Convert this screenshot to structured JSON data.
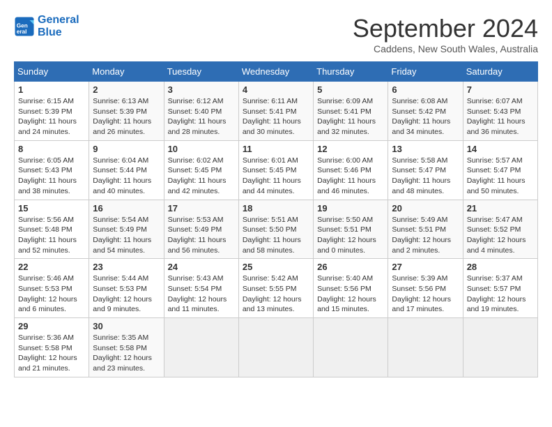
{
  "header": {
    "logo_line1": "General",
    "logo_line2": "Blue",
    "month_title": "September 2024",
    "subtitle": "Caddens, New South Wales, Australia"
  },
  "weekdays": [
    "Sunday",
    "Monday",
    "Tuesday",
    "Wednesday",
    "Thursday",
    "Friday",
    "Saturday"
  ],
  "weeks": [
    [
      {
        "day": "1",
        "sunrise": "6:15 AM",
        "sunset": "5:39 PM",
        "daylight": "11 hours and 24 minutes."
      },
      {
        "day": "2",
        "sunrise": "6:13 AM",
        "sunset": "5:39 PM",
        "daylight": "11 hours and 26 minutes."
      },
      {
        "day": "3",
        "sunrise": "6:12 AM",
        "sunset": "5:40 PM",
        "daylight": "11 hours and 28 minutes."
      },
      {
        "day": "4",
        "sunrise": "6:11 AM",
        "sunset": "5:41 PM",
        "daylight": "11 hours and 30 minutes."
      },
      {
        "day": "5",
        "sunrise": "6:09 AM",
        "sunset": "5:41 PM",
        "daylight": "11 hours and 32 minutes."
      },
      {
        "day": "6",
        "sunrise": "6:08 AM",
        "sunset": "5:42 PM",
        "daylight": "11 hours and 34 minutes."
      },
      {
        "day": "7",
        "sunrise": "6:07 AM",
        "sunset": "5:43 PM",
        "daylight": "11 hours and 36 minutes."
      }
    ],
    [
      {
        "day": "8",
        "sunrise": "6:05 AM",
        "sunset": "5:43 PM",
        "daylight": "11 hours and 38 minutes."
      },
      {
        "day": "9",
        "sunrise": "6:04 AM",
        "sunset": "5:44 PM",
        "daylight": "11 hours and 40 minutes."
      },
      {
        "day": "10",
        "sunrise": "6:02 AM",
        "sunset": "5:45 PM",
        "daylight": "11 hours and 42 minutes."
      },
      {
        "day": "11",
        "sunrise": "6:01 AM",
        "sunset": "5:45 PM",
        "daylight": "11 hours and 44 minutes."
      },
      {
        "day": "12",
        "sunrise": "6:00 AM",
        "sunset": "5:46 PM",
        "daylight": "11 hours and 46 minutes."
      },
      {
        "day": "13",
        "sunrise": "5:58 AM",
        "sunset": "5:47 PM",
        "daylight": "11 hours and 48 minutes."
      },
      {
        "day": "14",
        "sunrise": "5:57 AM",
        "sunset": "5:47 PM",
        "daylight": "11 hours and 50 minutes."
      }
    ],
    [
      {
        "day": "15",
        "sunrise": "5:56 AM",
        "sunset": "5:48 PM",
        "daylight": "11 hours and 52 minutes."
      },
      {
        "day": "16",
        "sunrise": "5:54 AM",
        "sunset": "5:49 PM",
        "daylight": "11 hours and 54 minutes."
      },
      {
        "day": "17",
        "sunrise": "5:53 AM",
        "sunset": "5:49 PM",
        "daylight": "11 hours and 56 minutes."
      },
      {
        "day": "18",
        "sunrise": "5:51 AM",
        "sunset": "5:50 PM",
        "daylight": "11 hours and 58 minutes."
      },
      {
        "day": "19",
        "sunrise": "5:50 AM",
        "sunset": "5:51 PM",
        "daylight": "12 hours and 0 minutes."
      },
      {
        "day": "20",
        "sunrise": "5:49 AM",
        "sunset": "5:51 PM",
        "daylight": "12 hours and 2 minutes."
      },
      {
        "day": "21",
        "sunrise": "5:47 AM",
        "sunset": "5:52 PM",
        "daylight": "12 hours and 4 minutes."
      }
    ],
    [
      {
        "day": "22",
        "sunrise": "5:46 AM",
        "sunset": "5:53 PM",
        "daylight": "12 hours and 6 minutes."
      },
      {
        "day": "23",
        "sunrise": "5:44 AM",
        "sunset": "5:53 PM",
        "daylight": "12 hours and 9 minutes."
      },
      {
        "day": "24",
        "sunrise": "5:43 AM",
        "sunset": "5:54 PM",
        "daylight": "12 hours and 11 minutes."
      },
      {
        "day": "25",
        "sunrise": "5:42 AM",
        "sunset": "5:55 PM",
        "daylight": "12 hours and 13 minutes."
      },
      {
        "day": "26",
        "sunrise": "5:40 AM",
        "sunset": "5:56 PM",
        "daylight": "12 hours and 15 minutes."
      },
      {
        "day": "27",
        "sunrise": "5:39 AM",
        "sunset": "5:56 PM",
        "daylight": "12 hours and 17 minutes."
      },
      {
        "day": "28",
        "sunrise": "5:37 AM",
        "sunset": "5:57 PM",
        "daylight": "12 hours and 19 minutes."
      }
    ],
    [
      {
        "day": "29",
        "sunrise": "5:36 AM",
        "sunset": "5:58 PM",
        "daylight": "12 hours and 21 minutes."
      },
      {
        "day": "30",
        "sunrise": "5:35 AM",
        "sunset": "5:58 PM",
        "daylight": "12 hours and 23 minutes."
      },
      null,
      null,
      null,
      null,
      null
    ]
  ]
}
